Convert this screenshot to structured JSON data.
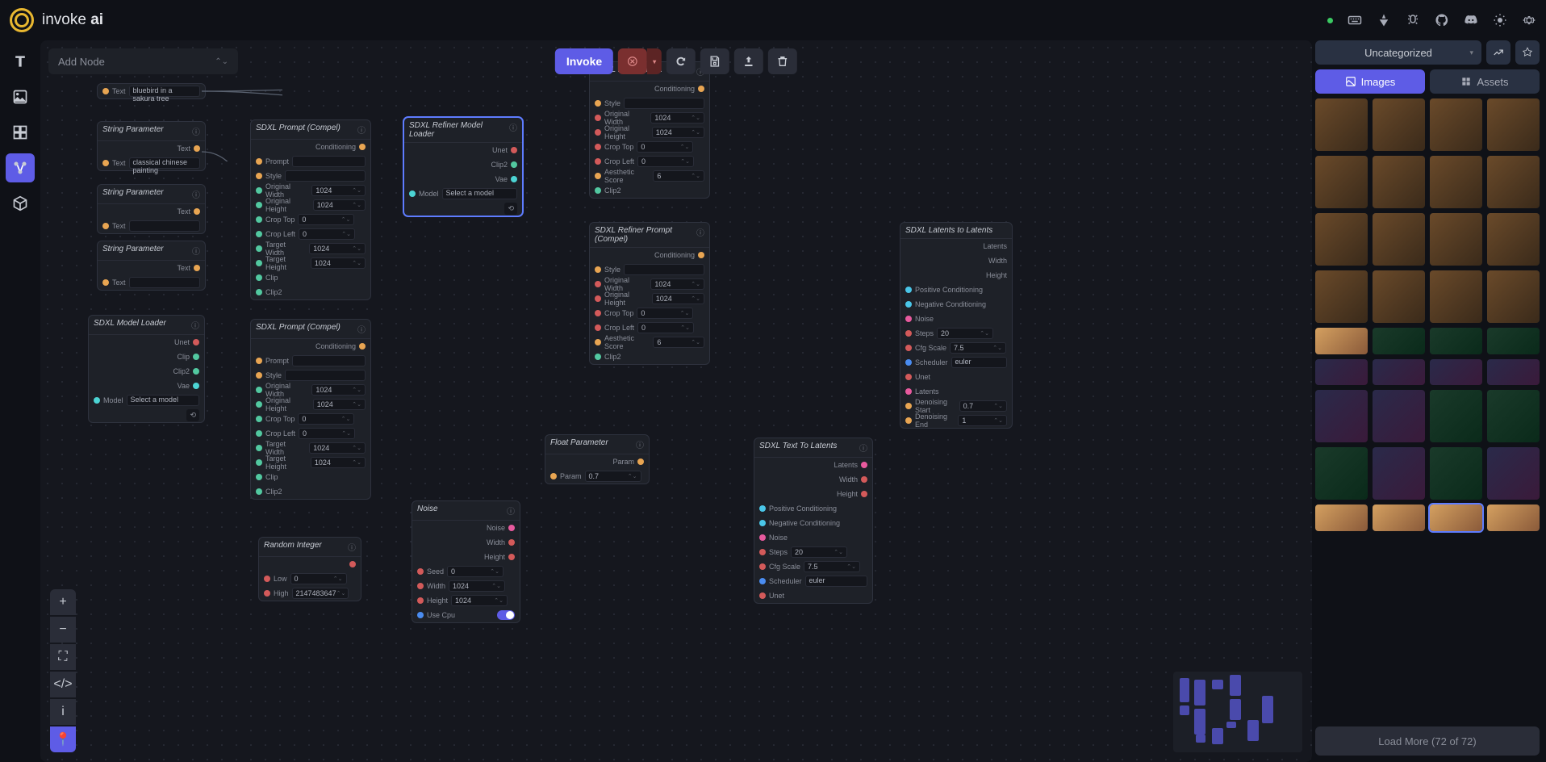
{
  "brand": {
    "prefix": "invoke ",
    "bold": "ai"
  },
  "toolbar": {
    "add_node": "Add Node",
    "invoke": "Invoke"
  },
  "rpanel": {
    "category": "Uncategorized",
    "tab_images": "Images",
    "tab_assets": "Assets",
    "load_more": "Load More (72 of 72)"
  },
  "nodes": {
    "text_param1": {
      "title": "",
      "label": "Text",
      "value": "bluebird in a sakura tree"
    },
    "string_param1": {
      "title": "String Parameter",
      "label": "Text",
      "value": "classical chinese painting"
    },
    "string_param2": {
      "title": "String Parameter",
      "label": "Text",
      "value": ""
    },
    "string_param3": {
      "title": "String Parameter",
      "label": "Text",
      "value": ""
    },
    "model_loader": {
      "title": "SDXL Model Loader",
      "unet": "Unet",
      "clip": "Clip",
      "clip2": "Clip2",
      "vae": "Vae",
      "model_lbl": "Model",
      "model_val": "Select a model"
    },
    "prompt1": {
      "title": "SDXL Prompt (Compel)",
      "cond": "Conditioning",
      "prompt": "Prompt",
      "style": "Style",
      "ow": "Original Width",
      "oh": "Original Height",
      "ct": "Crop Top",
      "cl": "Crop Left",
      "tw": "Target Width",
      "th": "Target Height",
      "clip": "Clip",
      "clip2": "Clip2",
      "v1024": "1024",
      "v0": "0"
    },
    "prompt2": {
      "title": "SDXL Prompt (Compel)"
    },
    "refiner_loader": {
      "title": "SDXL Refiner Model Loader",
      "unet": "Unet",
      "clip2": "Clip2",
      "vae": "Vae",
      "model_lbl": "Model",
      "model_val": "Select a model"
    },
    "refiner_pos": {
      "title": "SDXL Refiner Po...",
      "cond": "Conditioning",
      "style": "Style",
      "ow": "Original Width",
      "oh": "Original Height",
      "ct": "Crop Top",
      "cl": "Crop Left",
      "as": "Aesthetic Score",
      "clip2": "Clip2",
      "v1024": "1024",
      "v0": "0",
      "v6": "6"
    },
    "refiner_prompt": {
      "title": "SDXL Refiner Prompt (Compel)",
      "cond": "Conditioning",
      "style": "Style",
      "ow": "Original Width",
      "oh": "Original Height",
      "ct": "Crop Top",
      "cl": "Crop Left",
      "as": "Aesthetic Score",
      "clip2": "Clip2",
      "v1024": "1024",
      "v0": "0",
      "v6": "6"
    },
    "float_param": {
      "title": "Float Parameter",
      "param": "Param",
      "val": "0.7"
    },
    "noise": {
      "title": "Noise",
      "noise": "Noise",
      "width": "Width",
      "height": "Height",
      "seed": "Seed",
      "seedv": "0",
      "widthv": "1024",
      "heightv": "1024",
      "usecpu": "Use Cpu"
    },
    "rand_int": {
      "title": "Random Integer",
      "low": "Low",
      "high": "High",
      "lowv": "0",
      "highv": "2147483647"
    },
    "t2l": {
      "title": "SDXL Text To Latents",
      "latents": "Latents",
      "width": "Width",
      "height": "Height",
      "pc": "Positive Conditioning",
      "nc": "Negative Conditioning",
      "noise": "Noise",
      "steps": "Steps",
      "stepsv": "20",
      "cfg": "Cfg Scale",
      "cfgv": "7.5",
      "sched": "Scheduler",
      "schedv": "euler",
      "unet": "Unet"
    },
    "l2l": {
      "title": "SDXL Latents to Latents",
      "latents_out": "Latents",
      "width": "Width",
      "height": "Height",
      "pc": "Positive Conditioning",
      "nc": "Negative Conditioning",
      "noise": "Noise",
      "steps": "Steps",
      "stepsv": "20",
      "cfg": "Cfg Scale",
      "cfgv": "7.5",
      "sched": "Scheduler",
      "schedv": "euler",
      "unet": "Unet",
      "latents_in": "Latents",
      "ds": "Denoising Start",
      "dsv": "0.7",
      "de": "Denoising End",
      "dev": "1"
    }
  }
}
